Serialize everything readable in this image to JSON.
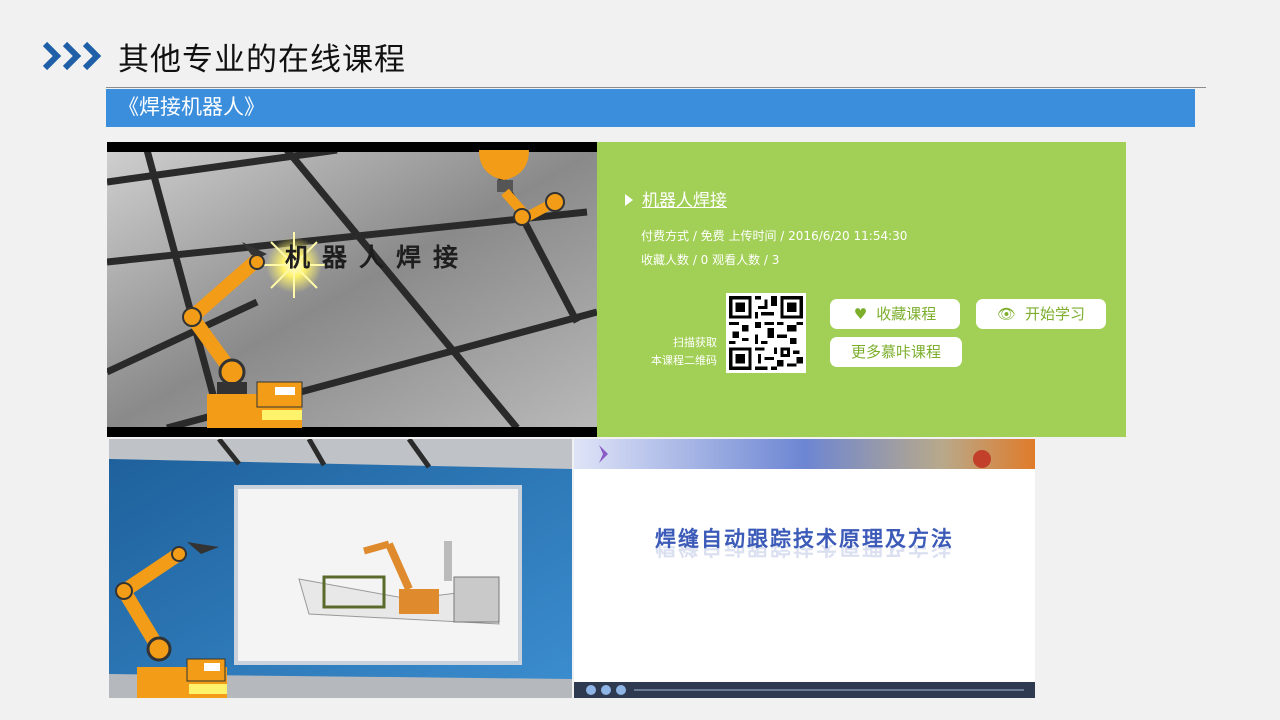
{
  "header": {
    "title": "其他专业的在线课程"
  },
  "banner": {
    "label": "《焊接机器人》"
  },
  "video": {
    "overlay_text": "机器人焊接"
  },
  "course": {
    "name": "机器人焊接",
    "meta_line1": "付费方式 / 免费 上传时间 / 2016/6/20 11:54:30",
    "meta_line2": "收藏人数 / 0 观看人数 / 3",
    "qr_caption_line1": "扫描获取",
    "qr_caption_line2": "本课程二维码"
  },
  "buttons": {
    "favorite": "收藏课程",
    "start": "开始学习",
    "more": "更多慕咔课程"
  },
  "slide": {
    "title": "焊缝自动跟踪技术原理及方法"
  },
  "icons": {
    "header": "triple-chevron-icon",
    "favorite": "heart-icon",
    "start": "eye-icon",
    "course": "play-triangle-icon"
  },
  "colors": {
    "banner": "#3a8edc",
    "panel": "#a2cf55",
    "chevron": "#1f5fa8",
    "robot": "#f29c17"
  }
}
